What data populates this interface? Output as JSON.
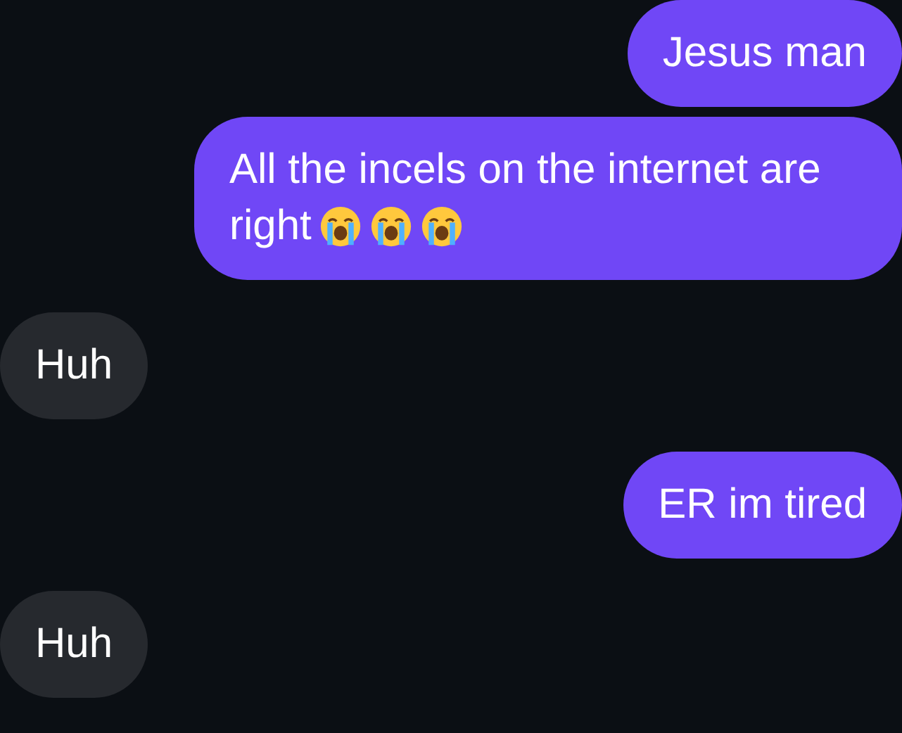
{
  "messages": [
    {
      "kind": "sent",
      "text": "Jesus man"
    },
    {
      "kind": "sent",
      "text": "All the incels on the internet are right",
      "icons": [
        {
          "kind": "crying-face"
        },
        {
          "kind": "crying-face"
        },
        {
          "kind": "crying-face"
        }
      ]
    },
    {
      "kind": "received",
      "text": "Huh"
    },
    {
      "kind": "sent",
      "text": "ER im tired"
    },
    {
      "kind": "received",
      "text": "Huh"
    }
  ]
}
